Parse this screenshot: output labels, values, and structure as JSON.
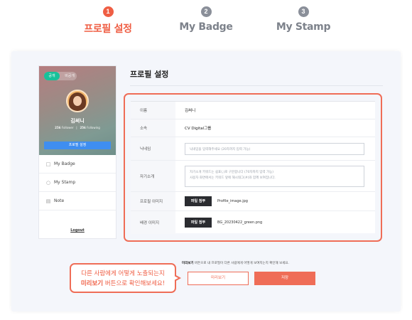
{
  "steps": [
    {
      "num": "1",
      "label": "프로필 설정"
    },
    {
      "num": "2",
      "label": "My Badge"
    },
    {
      "num": "3",
      "label": "My Stamp"
    }
  ],
  "colors": {
    "accent": "#ef6d57",
    "accent_text": "#ef5e44",
    "card_button": "#3f8ef0",
    "toggle_on": "#18c19a"
  },
  "card": {
    "toggle_on": "공개",
    "toggle_off": "비공개",
    "name": "김써니",
    "followers_count": "256",
    "followers_label": "Follower",
    "following_count": "256",
    "following_label": "Following",
    "button": "프로필 설정",
    "menu": [
      {
        "label": "My Badge",
        "icon": "badge-icon"
      },
      {
        "label": "My Stamp",
        "icon": "person-icon"
      },
      {
        "label": "Note",
        "icon": "note-icon"
      }
    ],
    "logout": "Logout"
  },
  "section_title": "프로필 설정",
  "form": {
    "name": {
      "label": "이름",
      "value": "김써니"
    },
    "affiliation": {
      "label": "소속",
      "value": "CV Digital그룹"
    },
    "nickname": {
      "label": "닉네임",
      "placeholder": "닉네임을 입력해주세요 (20자까지 입력 가능)"
    },
    "intro": {
      "label": "자기소개",
      "placeholder_1": "자기소개 키워드는 쉼표(,)로 구분합니다 (70자까지 입력 가능)",
      "placeholder_2": "사용자 화면에서는 키워드 앞에 해시태그(#)와 함께 보여집니다."
    },
    "profile_image": {
      "label": "프로필 이미지",
      "button": "파일 첨부",
      "file": "Profile_image.jpg"
    },
    "bg_image": {
      "label": "배경 이미지",
      "button": "파일 첨부",
      "file": "BG_20230422_green.png"
    }
  },
  "note": {
    "bold": "미리보기",
    "rest": " 버튼으로 내 프로필이 다른 사람에게 어떻게 보여지는지 확인해 보세요."
  },
  "actions": {
    "preview": "미리보기",
    "save": "저장"
  },
  "callout": {
    "line1": "다른 사람에게 어떻게 노출되는지",
    "line2_bold": "미리보기",
    "line2_rest": " 버튼으로 확인해보세요!"
  }
}
